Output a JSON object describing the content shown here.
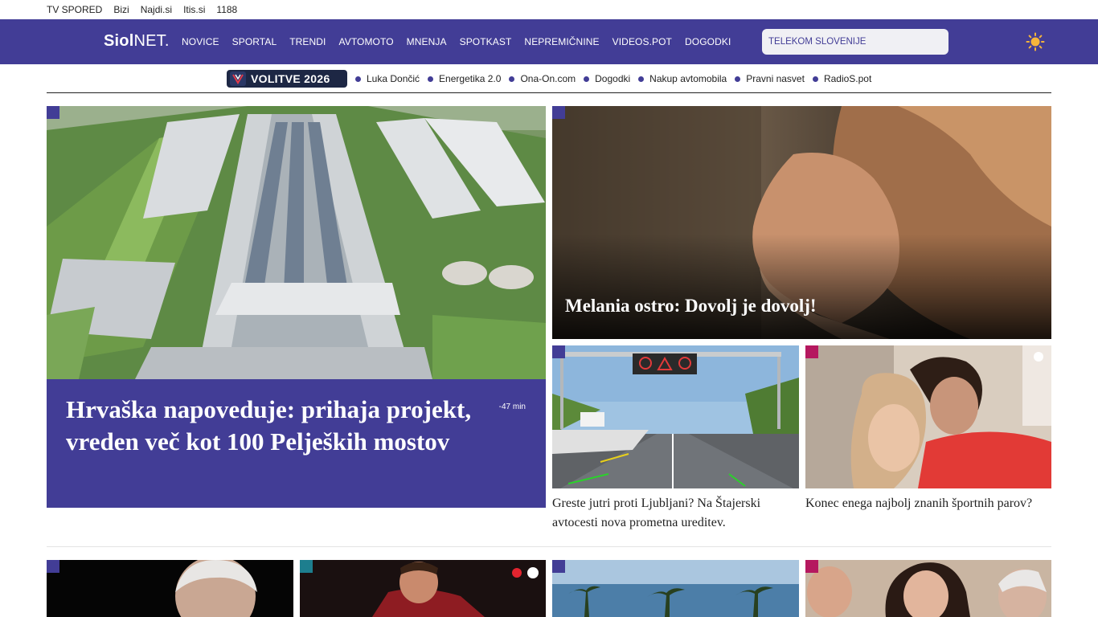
{
  "utility_links": [
    "TV SPORED",
    "Bizi",
    "Najdi.si",
    "Itis.si",
    "1188"
  ],
  "header": {
    "logo_bold": "Siol",
    "logo_light": "NET.",
    "nav": [
      "NOVICE",
      "SPORTAL",
      "TRENDI",
      "AVTOMOTO",
      "MNENJA",
      "SPOTKAST",
      "NEPREMIČNINE",
      "VIDEOS.POT",
      "DOGODKI"
    ],
    "search_placeholder": "TELEKOM SLOVENIJE",
    "theme_icon": "sun-icon"
  },
  "trending": {
    "badge": "VOLITVE 2026",
    "items": [
      "Luka Dončić",
      "Energetika 2.0",
      "Ona-On.com",
      "Dogodki",
      "Nakup avtomobila",
      "Pravni nasvet",
      "RadioS.pot"
    ]
  },
  "articles": {
    "lead": {
      "title": "Hrvaška napoveduje: prihaja projekt, vreden več kot 100 Peljeških mostov",
      "time": "-47 min"
    },
    "melania": {
      "title": "Melania ostro: Dovolj je dovolj!"
    },
    "road": {
      "title": "Greste jutri proti Ljubljani? Na Štajerski avtocesti nova prometna ureditev."
    },
    "couple": {
      "title": "Konec enega najbolj znanih športnih parov?"
    }
  },
  "colors": {
    "brand": "#423d96",
    "magenta": "#b5185f",
    "teal": "#1d7e8e"
  }
}
